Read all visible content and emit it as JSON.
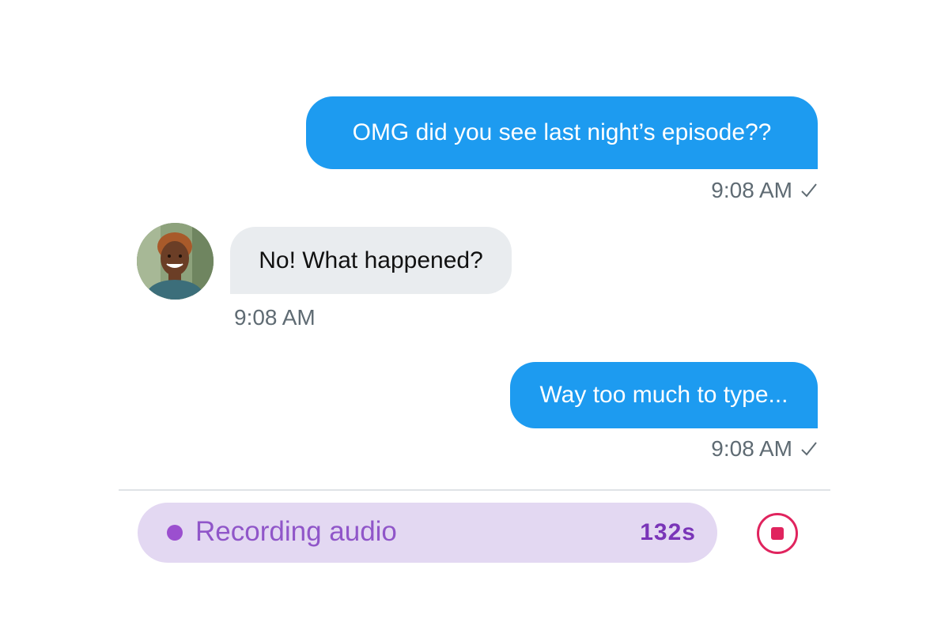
{
  "messages": [
    {
      "direction": "outgoing",
      "text": "OMG did you see last night’s episode??",
      "time": "9:08 AM",
      "status_icon": "check-icon"
    },
    {
      "direction": "incoming",
      "text": "No! What happened?",
      "time": "9:08 AM",
      "avatar": "avatar-photo"
    },
    {
      "direction": "outgoing",
      "text": "Way too much to type...",
      "time": "9:08 AM",
      "status_icon": "check-icon"
    }
  ],
  "recorder": {
    "label": "Recording audio",
    "elapsed": "132s",
    "indicator_color": "#9b4fcf",
    "background_color": "#e3d8f2"
  },
  "stop_button": {
    "icon": "stop-icon",
    "color": "#e0245e"
  },
  "colors": {
    "outgoing_bubble": "#1d9bf0",
    "incoming_bubble": "#e9ecef",
    "meta_text": "#5f6b73"
  }
}
